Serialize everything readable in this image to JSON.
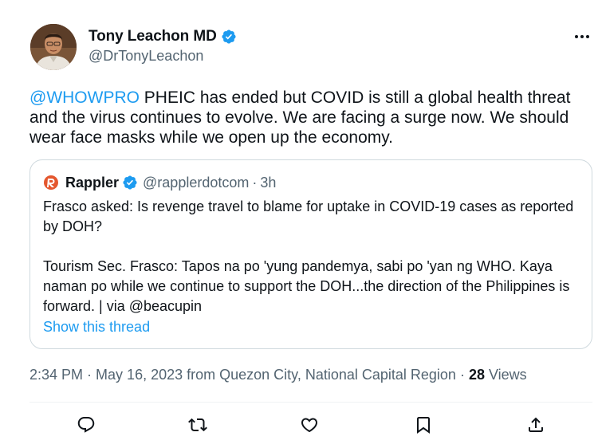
{
  "author": {
    "display_name": "Tony Leachon MD",
    "handle": "@DrTonyLeachon"
  },
  "icons": {
    "verified": "verified-badge-icon",
    "more": "more-options-icon",
    "reply": "reply-icon",
    "retweet": "retweet-icon",
    "like": "like-icon",
    "bookmark": "bookmark-icon",
    "share": "share-icon"
  },
  "tweet": {
    "mention": "@WHOWPRO",
    "text": " PHEIC has ended but COVID is still a global health threat and the virus continues to evolve. We are facing a surge now. We should wear face masks while we open up the economy."
  },
  "quote": {
    "name": "Rappler",
    "handle": "@rapplerdotcom",
    "separator": "·",
    "time": "3h",
    "paragraph1": "Frasco asked: Is revenge travel to blame for uptake in COVID-19 cases as reported by DOH?",
    "paragraph2": "Tourism Sec. Frasco: Tapos na po 'yung pandemya, sabi po 'yan ng WHO. Kaya naman po while we continue to support the DOH...the direction of the Philippines is forward. | via @beacupin",
    "show_thread": "Show this thread"
  },
  "meta": {
    "time": "2:34 PM",
    "dot1": "·",
    "date_location": "May 16, 2023 from Quezon City, National Capital Region",
    "dot2": "·",
    "views_count": "28",
    "views_label": "Views"
  },
  "colors": {
    "accent": "#1d9bf0",
    "text": "#0f1419",
    "secondary": "#536471",
    "border": "#cfd9de",
    "rappler_brand": "#e4572e"
  }
}
